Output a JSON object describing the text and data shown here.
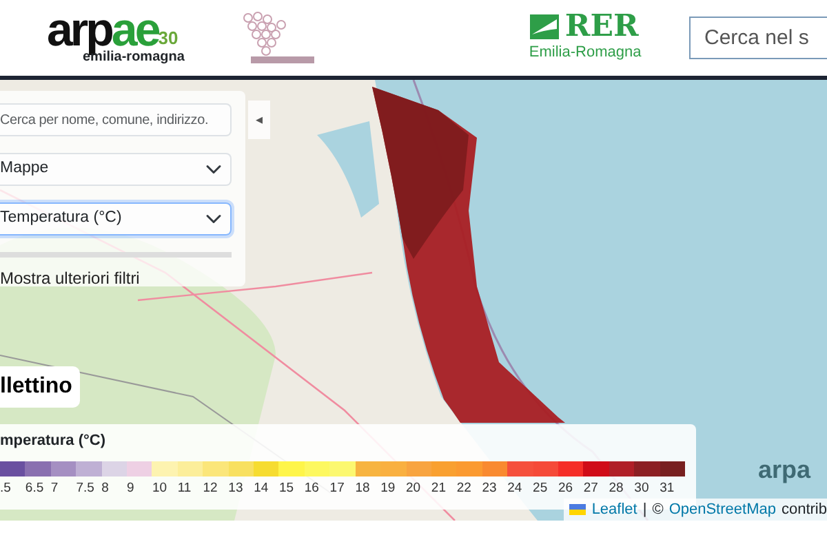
{
  "header": {
    "logo": {
      "main_dark": "arp",
      "main_green": "ae",
      "badge": "30",
      "sub": "emilia-romagna"
    },
    "region_logo": {
      "name": "RER",
      "sub": "Emilia-Romagna"
    },
    "search": {
      "placeholder": "Cerca nel s"
    }
  },
  "map_panel": {
    "search": {
      "placeholder": "Cerca per nome, comune, indirizzo."
    },
    "selects": [
      {
        "value": "Mappe",
        "focused": false
      },
      {
        "value": "Temperatura (°C)",
        "focused": true
      }
    ],
    "more_filters": "Mostra ulteriori filtri",
    "collapse_toggle": "◂"
  },
  "bulletin_button": "llettino",
  "legend": {
    "title": "mperatura (°C)",
    "steps": [
      {
        "label": ".5",
        "color": "#6a50a0"
      },
      {
        "label": "6.5",
        "color": "#8a70b0"
      },
      {
        "label": "7",
        "color": "#a58fc2"
      },
      {
        "label": "7.5",
        "color": "#bfb0d4"
      },
      {
        "label": "8",
        "color": "#dcd4e6"
      },
      {
        "label": "9",
        "color": "#eed0e4"
      },
      {
        "label": "10",
        "color": "#fdf3b0"
      },
      {
        "label": "11",
        "color": "#fcee9a"
      },
      {
        "label": "12",
        "color": "#fbe67a"
      },
      {
        "label": "13",
        "color": "#f8e060"
      },
      {
        "label": "14",
        "color": "#f6dc30"
      },
      {
        "label": "15",
        "color": "#fef54a"
      },
      {
        "label": "16",
        "color": "#fdf860"
      },
      {
        "label": "17",
        "color": "#fcf870"
      },
      {
        "label": "18",
        "color": "#f7b440"
      },
      {
        "label": "19",
        "color": "#f9b040"
      },
      {
        "label": "20",
        "color": "#f8a440"
      },
      {
        "label": "21",
        "color": "#f9a030"
      },
      {
        "label": "22",
        "color": "#fb9a30"
      },
      {
        "label": "23",
        "color": "#f98a30"
      },
      {
        "label": "24",
        "color": "#f5503c"
      },
      {
        "label": "25",
        "color": "#f54a38"
      },
      {
        "label": "26",
        "color": "#f52e28"
      },
      {
        "label": "27",
        "color": "#d00c18"
      },
      {
        "label": "28",
        "color": "#b02028"
      },
      {
        "label": "30",
        "color": "#8c2024"
      },
      {
        "label": "31",
        "color": "#782020"
      }
    ]
  },
  "map_logo": "arpa",
  "attribution": {
    "leaflet": "Leaflet",
    "separator": "|",
    "copyright": "©",
    "osm": "OpenStreetMap",
    "rest": "contrib"
  }
}
